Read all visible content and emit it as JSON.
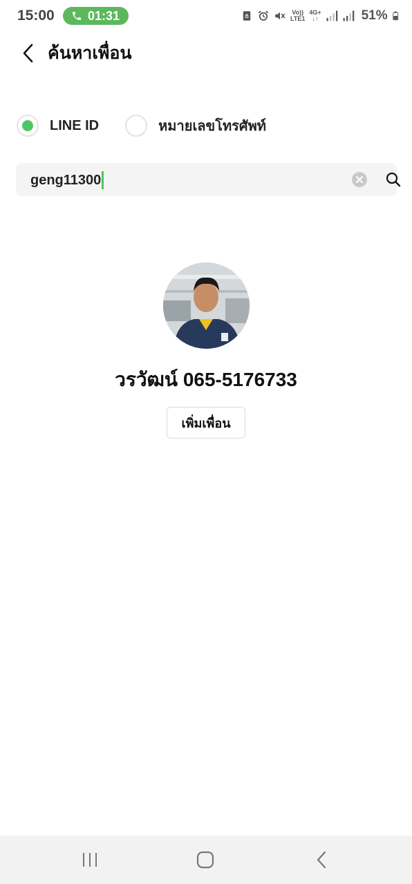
{
  "status_bar": {
    "time": "15:00",
    "call_timer": "01:31",
    "network_top": "Vo))",
    "network_bottom": "LTE1",
    "network_type": "4G+",
    "battery": "51%"
  },
  "header": {
    "title": "ค้นหาเพื่อน"
  },
  "search_type": {
    "options": [
      {
        "label": "LINE ID",
        "selected": true
      },
      {
        "label": "หมายเลขโทรศัพท์",
        "selected": false
      }
    ]
  },
  "search": {
    "value": "geng11300"
  },
  "result": {
    "name": "วรวัฒน์ 065-5176733",
    "add_label": "เพิ่มเพื่อน"
  },
  "colors": {
    "accent": "#4cc764",
    "call_pill": "#5cb85c"
  }
}
